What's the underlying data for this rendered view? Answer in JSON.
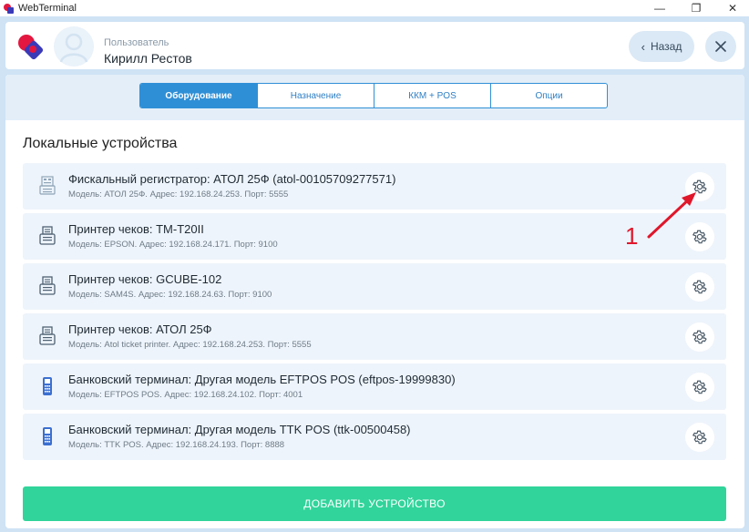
{
  "window": {
    "title": "WebTerminal",
    "min_glyph": "—",
    "max_glyph": "❐",
    "close_glyph": "✕"
  },
  "header": {
    "user_caption": "Пользователь",
    "user_name": "Кирилл Рестов",
    "back_label": "Назад",
    "back_icon": "chevron-left-icon",
    "close_icon": "close-icon"
  },
  "tabs": [
    {
      "label": "Оборудование",
      "active": true
    },
    {
      "label": "Назначение",
      "active": false
    },
    {
      "label": "ККМ + POS",
      "active": false
    },
    {
      "label": "Опции",
      "active": false
    }
  ],
  "section_title": "Локальные устройства",
  "devices": [
    {
      "icon": "fiscal-register-icon",
      "name": "Фискальный регистратор: АТОЛ 25Ф (atol-00105709277571)",
      "details": "Модель: АТОЛ 25Ф. Адрес: 192.168.24.253. Порт: 5555"
    },
    {
      "icon": "printer-icon",
      "name": "Принтер чеков: TM-T20II",
      "details": "Модель: EPSON. Адрес: 192.168.24.171. Порт: 9100"
    },
    {
      "icon": "printer-icon",
      "name": "Принтер чеков: GCUBE-102",
      "details": "Модель: SAM4S. Адрес: 192.168.24.63. Порт: 9100"
    },
    {
      "icon": "printer-icon",
      "name": "Принтер чеков: АТОЛ 25Ф",
      "details": "Модель: Atol ticket printer. Адрес: 192.168.24.253. Порт: 5555"
    },
    {
      "icon": "card-terminal-icon",
      "name": "Банковский терминал: Другая модель EFTPOS POS (eftpos-19999830)",
      "details": "Модель: EFTPOS POS. Адрес: 192.168.24.102. Порт: 4001"
    },
    {
      "icon": "card-terminal-icon",
      "name": "Банковский терминал: Другая модель TTK POS (ttk-00500458)",
      "details": "Модель: TTK POS. Адрес: 192.168.24.193. Порт: 8888"
    }
  ],
  "annotation": {
    "number": "1",
    "color": "#e0162b"
  },
  "add_button_label": "ДОБАВИТЬ УСТРОЙСТВО",
  "colors": {
    "accent": "#2f8fd6",
    "add_button": "#31d49b",
    "brand_red": "#e3173f",
    "brand_blue": "#3a3ab8"
  }
}
